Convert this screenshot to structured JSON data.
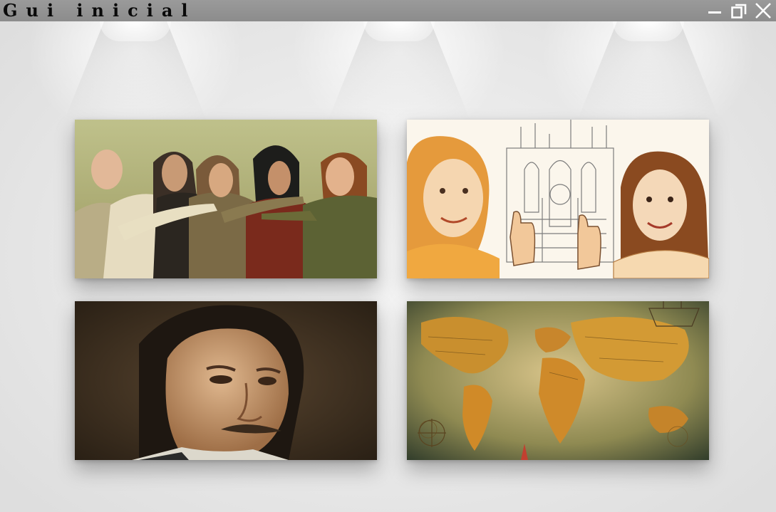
{
  "window": {
    "title": "Gui inicial",
    "controls": [
      {
        "name": "minimize",
        "icon": "minimize-icon"
      },
      {
        "name": "maximize",
        "icon": "restore-icon"
      },
      {
        "name": "close",
        "icon": "close-icon"
      }
    ]
  },
  "gallery": {
    "paintings": [
      {
        "icon": "renaissance-men-pointing-image"
      },
      {
        "icon": "two-women-thumbs-up-cathedral-image"
      },
      {
        "icon": "bearded-man-portrait-image"
      },
      {
        "icon": "antique-world-map-image"
      }
    ]
  },
  "colors": {
    "titlebar": "#8f8f8f",
    "wall": "#e8e8e8"
  }
}
